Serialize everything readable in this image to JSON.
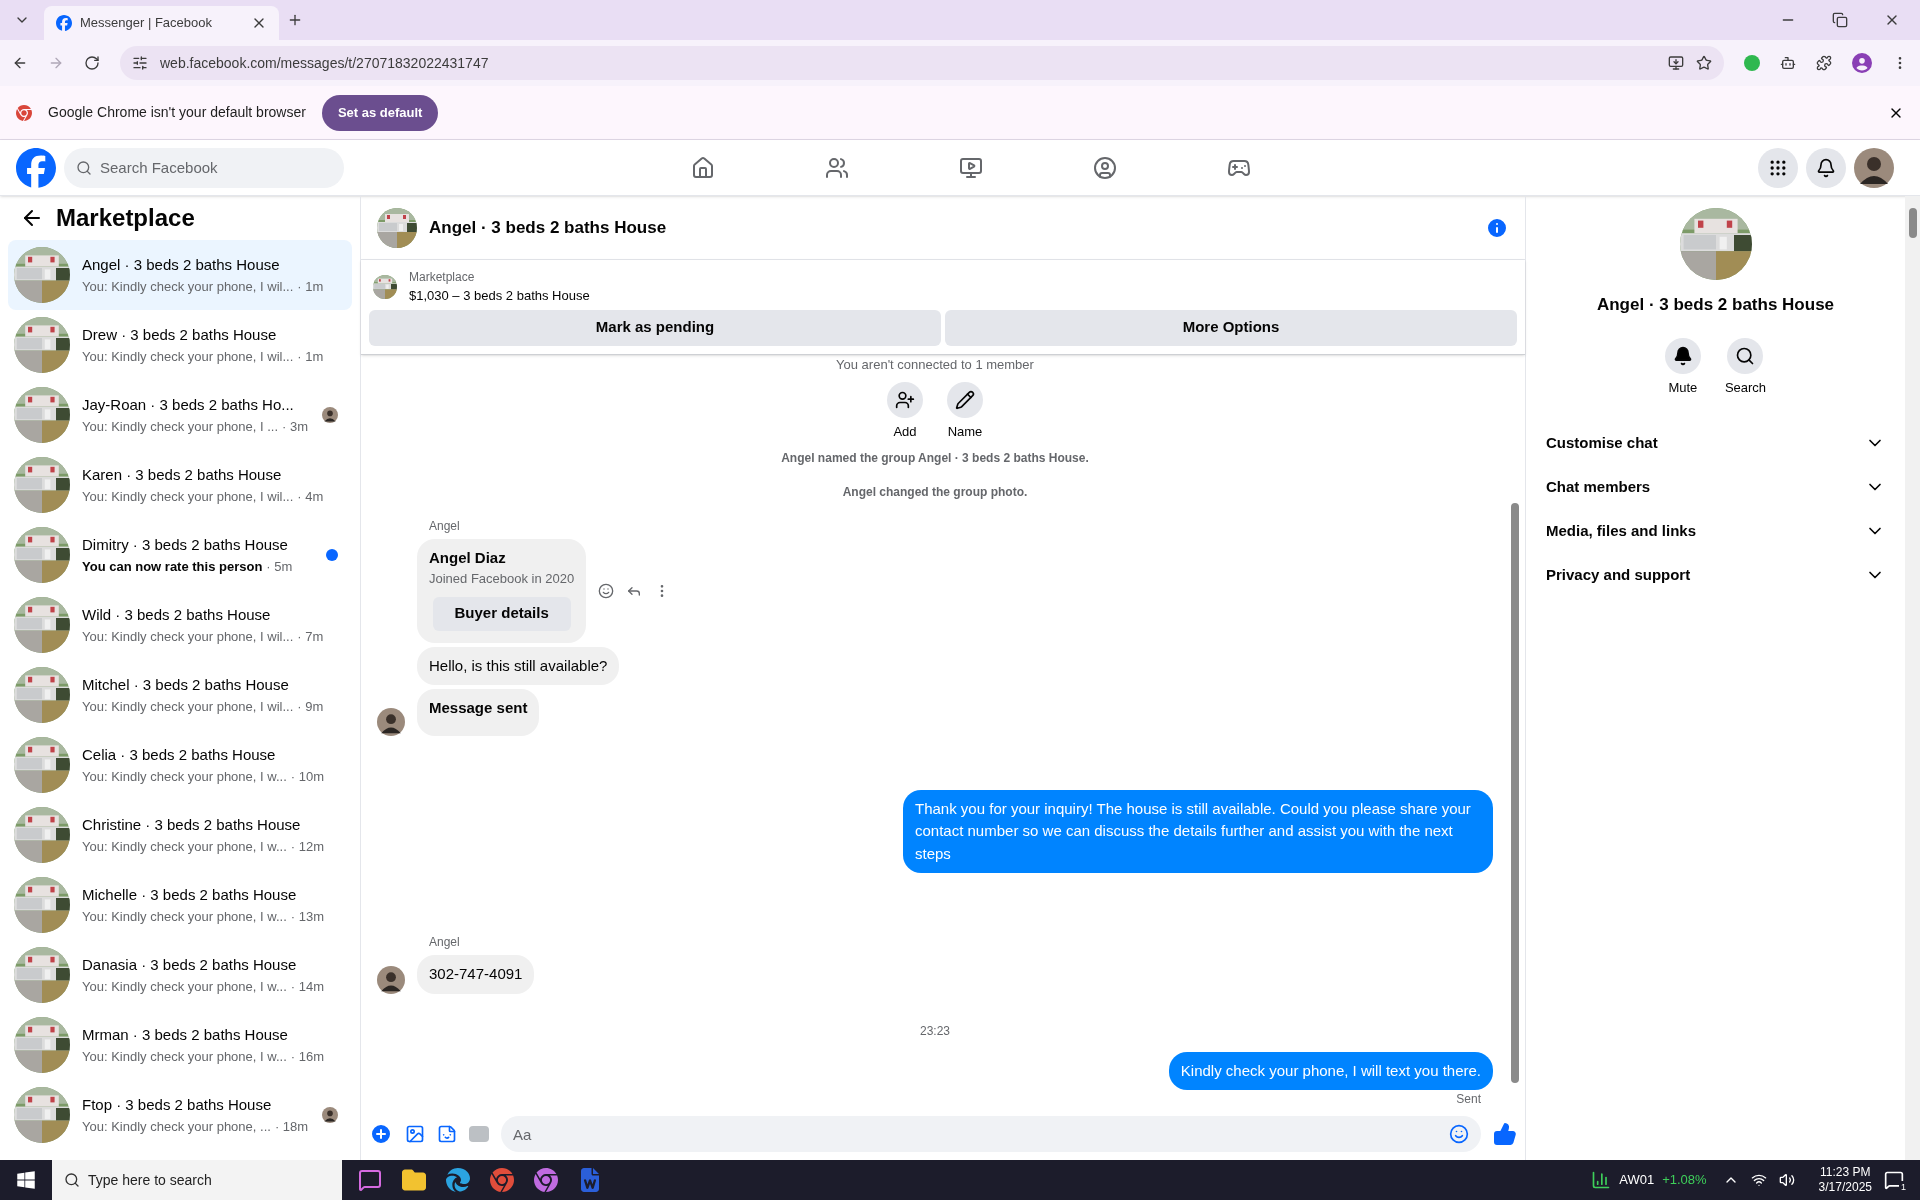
{
  "browser": {
    "tabs": [
      {
        "title": "Messenger | Facebook",
        "selected": true
      }
    ],
    "url": "web.facebook.com/messages/t/27071832022431747",
    "infobar": {
      "message": "Google Chrome isn't your default browser",
      "button": "Set as default"
    }
  },
  "facebook": {
    "search_placeholder": "Search Facebook"
  },
  "sidebar": {
    "title": "Marketplace",
    "conversations": [
      {
        "name": "Angel · 3 beds 2 baths House",
        "preview": "You: Kindly check your phone, I wil...",
        "time": "· 1m",
        "selected": true,
        "unread": false,
        "seen": false
      },
      {
        "name": "Drew · 3 beds 2 baths House",
        "preview": "You: Kindly check your phone, I wil...",
        "time": "· 1m",
        "selected": false,
        "unread": false,
        "seen": false
      },
      {
        "name": "Jay-Roan · 3 beds 2 baths Ho...",
        "preview": "You: Kindly check your phone, I ...",
        "time": "· 3m",
        "selected": false,
        "unread": false,
        "seen": true
      },
      {
        "name": "Karen · 3 beds 2 baths House",
        "preview": "You: Kindly check your phone, I wil...",
        "time": "· 4m",
        "selected": false,
        "unread": false,
        "seen": false
      },
      {
        "name": "Dimitry · 3 beds 2 baths House",
        "preview": "You can now rate this person",
        "time": "· 5m",
        "selected": false,
        "unread": true,
        "seen": false
      },
      {
        "name": "Wild · 3 beds 2 baths House",
        "preview": "You: Kindly check your phone, I wil...",
        "time": "· 7m",
        "selected": false,
        "unread": false,
        "seen": false
      },
      {
        "name": "Mitchel · 3 beds 2 baths House",
        "preview": "You: Kindly check your phone, I wil...",
        "time": "· 9m",
        "selected": false,
        "unread": false,
        "seen": false
      },
      {
        "name": "Celia · 3 beds 2 baths House",
        "preview": "You: Kindly check your phone, I w...",
        "time": "· 10m",
        "selected": false,
        "unread": false,
        "seen": false
      },
      {
        "name": "Christine · 3 beds 2 baths House",
        "preview": "You: Kindly check your phone, I w...",
        "time": "· 12m",
        "selected": false,
        "unread": false,
        "seen": false
      },
      {
        "name": "Michelle · 3 beds 2 baths House",
        "preview": "You: Kindly check your phone, I w...",
        "time": "· 13m",
        "selected": false,
        "unread": false,
        "seen": false
      },
      {
        "name": "Danasia · 3 beds 2 baths House",
        "preview": "You: Kindly check your phone, I w...",
        "time": "· 14m",
        "selected": false,
        "unread": false,
        "seen": false
      },
      {
        "name": "Mrman · 3 beds 2 baths House",
        "preview": "You: Kindly check your phone, I w...",
        "time": "· 16m",
        "selected": false,
        "unread": false,
        "seen": false
      },
      {
        "name": "Ftop · 3 beds 2 baths House",
        "preview": "You: Kindly check your phone, ...",
        "time": "· 18m",
        "selected": false,
        "unread": false,
        "seen": true
      }
    ]
  },
  "chat": {
    "title": "Angel · 3 beds 2 baths House",
    "listing": {
      "label": "Marketplace",
      "title": "$1,030 – 3 beds 2 baths House"
    },
    "actions": [
      "Mark as pending",
      "More Options"
    ],
    "notice": "You aren't connected to 1 member",
    "quick_actions": [
      {
        "kind": "add",
        "label": "Add"
      },
      {
        "kind": "name",
        "label": "Name"
      }
    ],
    "messages": [
      {
        "kind": "event",
        "text": "Angel named the group Angel · 3 beds 2 baths House."
      },
      {
        "kind": "event",
        "text": "Angel changed the group photo."
      },
      {
        "kind": "sender",
        "text": "Angel"
      },
      {
        "kind": "card",
        "name": "Angel Diaz",
        "subtitle": "Joined Facebook in 2020",
        "button": "Buyer details"
      },
      {
        "kind": "in",
        "text": "Hello, is this still available?",
        "bold": false,
        "avatar": false
      },
      {
        "kind": "in",
        "text": "Message sent",
        "bold": true,
        "avatar": true
      },
      {
        "kind": "out",
        "text": "Thank you for your inquiry! The house is still available. Could you please share your contact number so we can discuss the details further and assist you with the next steps"
      },
      {
        "kind": "sender",
        "text": "Angel"
      },
      {
        "kind": "in",
        "text": "302-747-4091",
        "bold": false,
        "avatar": true
      },
      {
        "kind": "time",
        "text": "23:23"
      },
      {
        "kind": "out",
        "text": "Kindly check your phone, I will text you there."
      },
      {
        "kind": "status",
        "text": "Sent"
      }
    ],
    "composer_placeholder": "Aa"
  },
  "info_panel": {
    "title": "Angel · 3 beds 2 baths House",
    "actions": [
      {
        "kind": "mute",
        "label": "Mute"
      },
      {
        "kind": "search",
        "label": "Search"
      }
    ],
    "sections": [
      "Customise chat",
      "Chat members",
      "Media, files and links",
      "Privacy and support"
    ]
  },
  "taskbar": {
    "search_placeholder": "Type here to search",
    "stock": {
      "ticker": "AW01",
      "change": "+1.08%"
    },
    "time": "11:23 PM",
    "date": "3/17/2025",
    "notifications": "1"
  }
}
